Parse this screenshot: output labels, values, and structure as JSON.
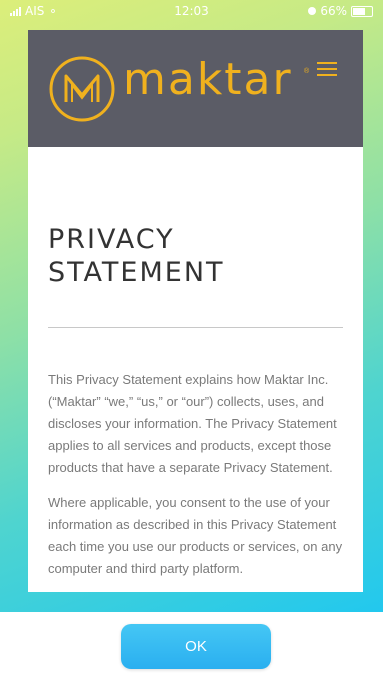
{
  "status_bar": {
    "carrier": "AIS",
    "time": "12:03",
    "battery": "66%",
    "battery_level": 0.66
  },
  "header": {
    "logo_text": "maktar",
    "registered_mark": "®",
    "menu_icon": "hamburger-menu-icon",
    "brand_color": "#f0b11e",
    "background_color": "#5b5c66"
  },
  "document": {
    "title": "PRIVACY STATEMENT",
    "paragraphs": [
      "This Privacy Statement explains how Maktar Inc. (“Maktar” “we,” “us,” or “our”) collects, uses, and discloses your information. The Privacy Statement applies to all services and products, except those products that have a separate Privacy Statement.",
      "Where applicable, you consent to the use of your information as described in this Privacy Statement each time you use our products or services, on any computer and third party platform."
    ]
  },
  "footer": {
    "ok_label": "OK",
    "accent_color": "#35b9f2"
  }
}
